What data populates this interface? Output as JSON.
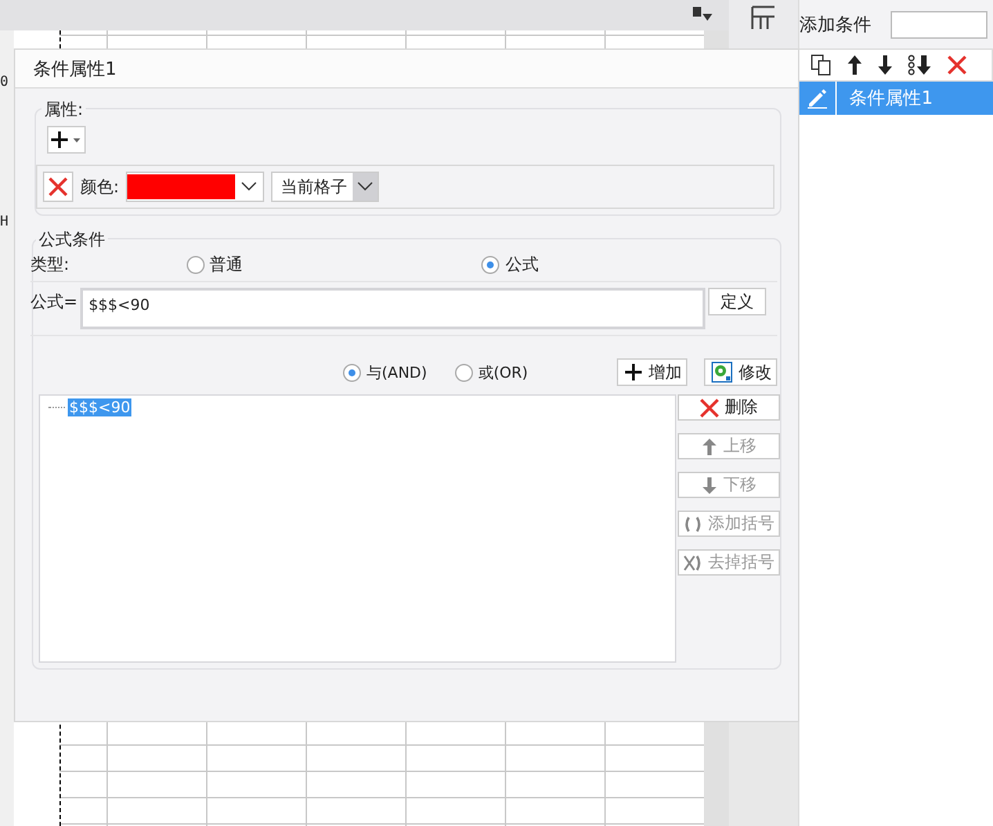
{
  "sheet": {
    "column_marker": "0",
    "row_marker": "H"
  },
  "side_panel": {
    "label": "添加条件",
    "toolbar": [
      {
        "kind": "copy"
      },
      {
        "kind": "up"
      },
      {
        "kind": "down"
      },
      {
        "kind": "move"
      },
      {
        "kind": "delete"
      }
    ],
    "items": [
      {
        "label": "条件属性1",
        "selected": true
      }
    ]
  },
  "dialog": {
    "title": "条件属性1",
    "attributes": {
      "legend": "属性:",
      "rows": [
        {
          "kind": "color",
          "label": "颜色:",
          "color": "#ff0000",
          "scope": "当前格子"
        }
      ]
    },
    "formula_condition": {
      "legend": "公式条件",
      "type_label": "类型:",
      "types": [
        {
          "label": "普通",
          "selected": false
        },
        {
          "label": "公式",
          "selected": true
        }
      ],
      "formula_label": "公式=",
      "formula": "$$$<90",
      "define_button": "定义",
      "logic": [
        {
          "label": "与(AND)",
          "selected": true
        },
        {
          "label": "或(OR)",
          "selected": false
        }
      ],
      "actions": [
        {
          "kind": "add",
          "label": "增加"
        },
        {
          "kind": "edit",
          "label": "修改"
        }
      ],
      "conditions": [
        {
          "label": "$$$<90",
          "selected": true
        }
      ],
      "side_buttons": [
        {
          "kind": "delete",
          "label": "删除",
          "disabled": false
        },
        {
          "kind": "up",
          "label": "上移",
          "disabled": true
        },
        {
          "kind": "down",
          "label": "下移",
          "disabled": true
        },
        {
          "kind": "add_bracket",
          "label": "添加括号",
          "disabled": true
        },
        {
          "kind": "remove_bracket",
          "label": "去掉括号",
          "disabled": true
        }
      ]
    }
  }
}
